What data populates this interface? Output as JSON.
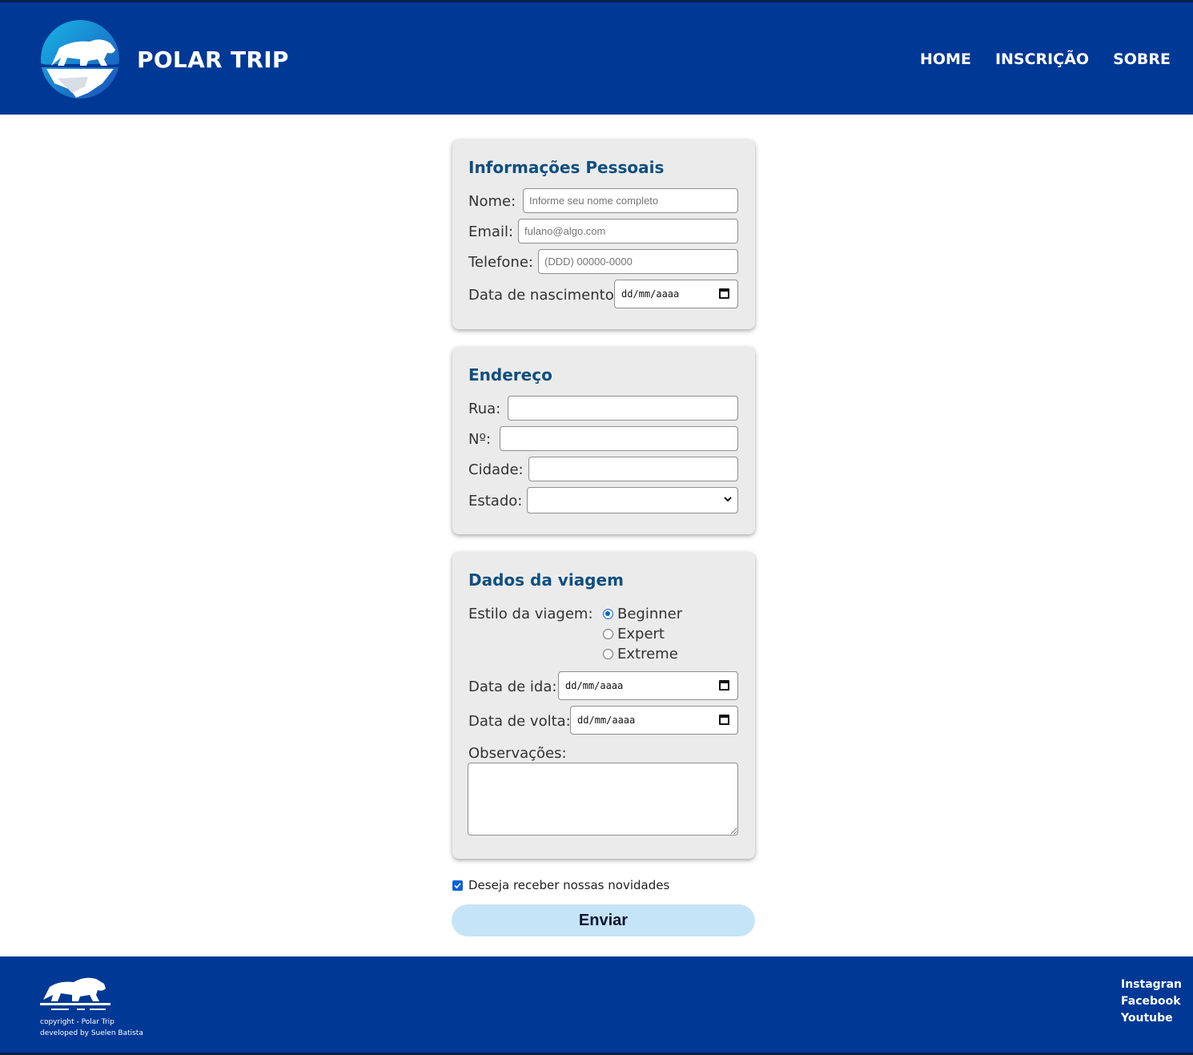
{
  "header": {
    "brand": "POLAR TRIP",
    "nav": [
      "HOME",
      "INSCRIÇÃO",
      "SOBRE"
    ]
  },
  "personal": {
    "title": "Informações Pessoais",
    "nome_label": "Nome:",
    "nome_placeholder": "Informe seu nome completo",
    "email_label": "Email:",
    "email_placeholder": "fulano@algo.com",
    "telefone_label": "Telefone:",
    "telefone_placeholder": "(DDD) 00000-0000",
    "nascimento_label": "Data de nascimento:",
    "date_placeholder": "dd/mm/aaaa"
  },
  "address": {
    "title": "Endereço",
    "rua_label": "Rua:",
    "numero_label": "Nº:",
    "cidade_label": "Cidade:",
    "estado_label": "Estado:",
    "estado_value": ""
  },
  "trip": {
    "title": "Dados da viagem",
    "estilo_label": "Estilo da viagem:",
    "styles": [
      "Beginner",
      "Expert",
      "Extreme"
    ],
    "selected_style": "Beginner",
    "ida_label": "Data de ida:",
    "volta_label": "Data de volta:",
    "date_placeholder": "dd/mm/aaaa",
    "obs_label": "Observações:"
  },
  "newsletter": {
    "label": "Deseja receber nossas novidades",
    "checked": true
  },
  "submit_label": "Enviar",
  "footer": {
    "copyright": "copyright - Polar Trip",
    "developer": "developed by Suelen Batista",
    "social": [
      "Instagran",
      "Facebook",
      "Youtube"
    ]
  },
  "colors": {
    "header_bg": "#003896",
    "card_bg": "#ebebeb",
    "heading": "#0e4f7f",
    "button_bg": "#c6e4f7",
    "accent": "#0b62d8"
  }
}
